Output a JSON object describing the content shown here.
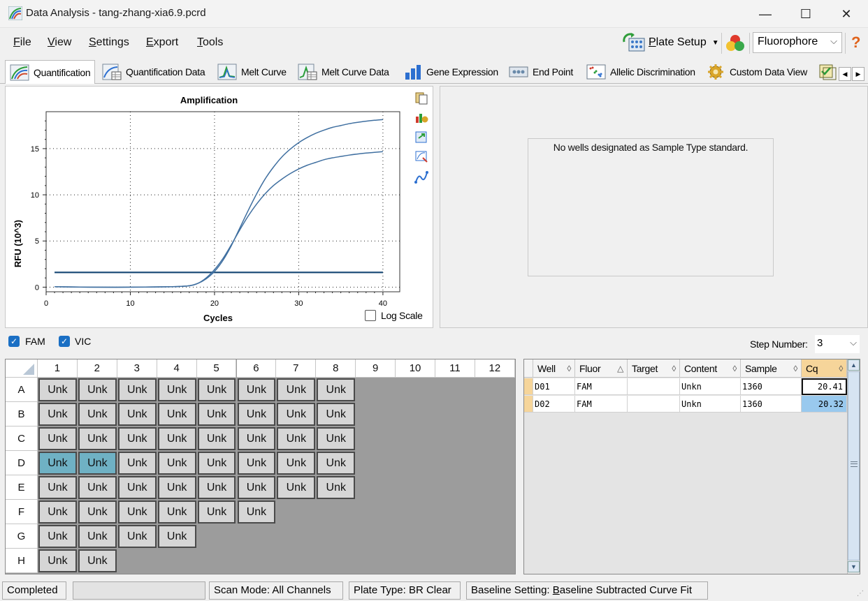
{
  "window": {
    "title": "Data Analysis - tang-zhang-xia6.9.pcrd",
    "minimize": "—",
    "maximize": "☐",
    "close": "✕"
  },
  "menu": [
    {
      "label": "File",
      "hotkey": "F",
      "rest": "ile"
    },
    {
      "label": "View",
      "hotkey": "V",
      "rest": "iew"
    },
    {
      "label": "Settings",
      "hotkey": "S",
      "rest": "ettings"
    },
    {
      "label": "Export",
      "hotkey": "E",
      "rest": "xport"
    },
    {
      "label": "Tools",
      "hotkey": "T",
      "rest": "ools"
    }
  ],
  "toolbar": {
    "plate_setup": "Plate Setup",
    "plate_setup_hotkey": "P",
    "plate_setup_rest": "late Setup",
    "fluor_select": "Fluorophore",
    "help": "?"
  },
  "tabs": [
    {
      "label": "Quantification",
      "icon": "amplification-icon",
      "active": true
    },
    {
      "label": "Quantification Data",
      "icon": "quant-data-icon"
    },
    {
      "label": "Melt Curve",
      "icon": "melt-curve-icon"
    },
    {
      "label": "Melt Curve Data",
      "icon": "melt-data-icon"
    },
    {
      "label": "Gene Expression",
      "icon": "bar-chart-icon"
    },
    {
      "label": "End Point",
      "icon": "end-point-icon"
    },
    {
      "label": "Allelic Discrimination",
      "icon": "scatter-icon"
    },
    {
      "label": "Custom Data View",
      "icon": "gear-icon"
    }
  ],
  "chart_data": {
    "type": "line",
    "title": "Amplification",
    "xlabel": "Cycles",
    "ylabel": "RFU (10^3)",
    "xlim": [
      0,
      42
    ],
    "ylim": [
      -0.5,
      19
    ],
    "xticks": [
      0,
      10,
      20,
      30,
      40
    ],
    "yticks": [
      0,
      5,
      10,
      15
    ],
    "grid": true,
    "threshold": 1.6,
    "series": [
      {
        "x": [
          1,
          5,
          10,
          15,
          17,
          18,
          19,
          20,
          21,
          22,
          23,
          24,
          25,
          26,
          27,
          28,
          29,
          30,
          31,
          32,
          33,
          34,
          35,
          36,
          37,
          38,
          39,
          40
        ],
        "values": [
          0.05,
          0.0,
          0.0,
          0.05,
          0.15,
          0.4,
          0.9,
          1.7,
          2.9,
          4.5,
          6.4,
          8.3,
          10.1,
          11.7,
          13.0,
          14.1,
          14.95,
          15.65,
          16.2,
          16.65,
          17.0,
          17.3,
          17.5,
          17.7,
          17.85,
          17.97,
          18.07,
          18.15
        ]
      },
      {
        "x": [
          1,
          5,
          10,
          15,
          17,
          18,
          19,
          20,
          21,
          22,
          23,
          24,
          25,
          26,
          27,
          28,
          29,
          30,
          31,
          32,
          33,
          34,
          35,
          36,
          37,
          38,
          39,
          40
        ],
        "values": [
          0.05,
          0.0,
          0.0,
          0.05,
          0.15,
          0.4,
          1.0,
          1.9,
          3.1,
          4.6,
          6.2,
          7.7,
          9.0,
          10.1,
          11.0,
          11.7,
          12.3,
          12.8,
          13.2,
          13.5,
          13.8,
          14.0,
          14.15,
          14.3,
          14.42,
          14.52,
          14.6,
          14.67
        ]
      }
    ]
  },
  "chart_options": {
    "log_scale": "Log Scale"
  },
  "standard_message": "No wells designated as Sample Type standard.",
  "fluors": [
    "FAM",
    "VIC"
  ],
  "step": {
    "label": "Step Number:",
    "value": "3"
  },
  "plate": {
    "columns": [
      "1",
      "2",
      "3",
      "4",
      "5",
      "6",
      "7",
      "8",
      "9",
      "10",
      "11",
      "12"
    ],
    "rows": [
      "A",
      "B",
      "C",
      "D",
      "E",
      "F",
      "G",
      "H"
    ],
    "well_label": "Unk",
    "filled": {
      "A": 8,
      "B": 8,
      "C": 8,
      "D": 8,
      "E": 8,
      "F": 6,
      "G": 4,
      "H": 2
    },
    "selected": [
      "D1",
      "D2"
    ]
  },
  "results": {
    "columns": [
      "Well",
      "Fluor",
      "Target",
      "Content",
      "Sample",
      "Cq"
    ],
    "rows": [
      {
        "well": "D01",
        "fluor": "FAM",
        "target": "",
        "content": "Unkn",
        "sample": "1360",
        "cq": "20.41"
      },
      {
        "well": "D02",
        "fluor": "FAM",
        "target": "",
        "content": "Unkn",
        "sample": "1360",
        "cq": "20.32"
      }
    ]
  },
  "status": {
    "state": "Completed",
    "scan_mode": "Scan Mode: All Channels",
    "plate_type": "Plate Type: BR Clear",
    "baseline_prefix": "Baseline Setting: ",
    "baseline_hotkey": "B",
    "baseline_rest": "aseline Subtracted Curve Fit"
  },
  "colors": {
    "curve": "#3f6fa0",
    "threshold": "#1f4e79",
    "selected_well": "#6fb1c4",
    "cq_highlight": "#99c9ee"
  }
}
